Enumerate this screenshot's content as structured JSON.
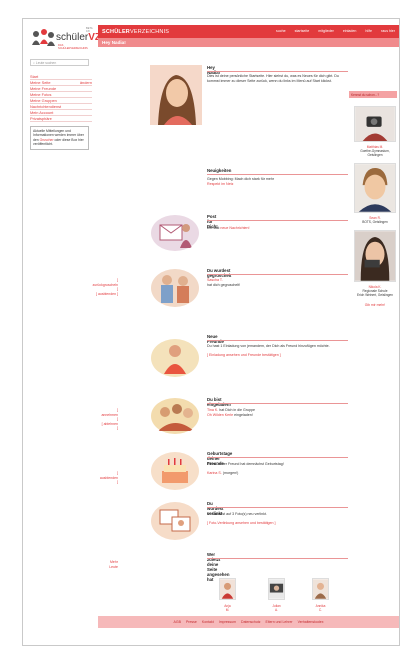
{
  "brand": {
    "name_bold": "SCHÜLER",
    "name_light": "VERZEICHNIS",
    "logo_text_1": "schüler",
    "logo_text_2": "VZ",
    "logo_tag": "DAS SCHÜLERVERZEICHNIS",
    "beta": "BETA 0.8"
  },
  "topnav": [
    "suche",
    "startseite",
    "mitglieder",
    "einladen",
    "hilfe",
    "raus hier"
  ],
  "subbar": {
    "greeting": "Hey Nadia!"
  },
  "sidebar": {
    "search_placeholder": "Leute suchen",
    "items": [
      "Start",
      "Meine Seite",
      "Meine Freunde",
      "Meine Fotos",
      "Meine Gruppen",
      "Nachrichtendienst",
      "Mein Account",
      "Privatsphäre"
    ],
    "edit_label": "ändern",
    "info_text_1": "Aktuelle Mitteilungen und Informationen werden immer über den",
    "info_link": "Gruscher",
    "info_text_2": "oder diese Box hier veröffentlicht."
  },
  "sections": {
    "welcome": {
      "title": "Hey Nadia!",
      "text": "Dies ist deine persönliche Startseite. Hier siehst du, was es Neues für dich gibt. Du kommst immer zu dieser Seite zurück, wenn du links im Menü auf Start klickst."
    },
    "news": {
      "title": "Neuigkeiten",
      "text": "Gegen Mobbing: Mach dich stark für mehr",
      "link": "Respekt im Netz"
    },
    "mail": {
      "title": "Post für Dich!",
      "text": "Du hast",
      "link": "neue Nachrichten!"
    },
    "poke": {
      "title": "Du wurdest gegruschelt",
      "name": "Sascha T.",
      "text": "hat dich gegruschelt!",
      "action1": "[ zurückgruscheln ]",
      "action2": "[ ausblenden ]"
    },
    "friends": {
      "title": "Neue Freunde",
      "text": "Du hast 1 Einladung von jemandem, der Dich als Freund hinzufügen möchte.",
      "link": "[ Einladung ansehen und Freunde bestätigen ]"
    },
    "invite": {
      "title": "Du bist eingeladen!",
      "line1_name": "Tina K.",
      "line1_text": "hat Dich in die Gruppe",
      "line2_link": "Oh Wilden Kerle",
      "line2_text": "eingeladen!",
      "action1": "[ annehmen ]",
      "action2": "[ ablehnen ]"
    },
    "birthday": {
      "title": "Geburtstage deiner Freunde",
      "text": "Einer Deiner Freund hat demnächst Geburtstag!",
      "name": "Karina S.",
      "when": "(morgen!)",
      "action": "[ ausblenden ]"
    },
    "tagged": {
      "title": "Du wurdest verlinkt",
      "text": "Du wurdest auf 3 Foto(s) neu verlinkt.",
      "link": "[ Foto-Verlinkung ansehen und bestätigen ]"
    },
    "visitors": {
      "title": "Wer zuletzt deine Seite angesehen hat",
      "more": "Mehr Leute",
      "people": [
        {
          "first": "Anja",
          "last": "M."
        },
        {
          "first": "Julian",
          "last": "A."
        },
        {
          "first": "Annika",
          "last": "C."
        }
      ]
    }
  },
  "rightcol": {
    "header": "Kennst du schon...?",
    "people": [
      {
        "name": "Matthias M.",
        "school": "Goethe-Gymnasium,",
        "city": "Geislingen"
      },
      {
        "name": "Sean R.",
        "school": "BOTS, Geislingen",
        "city": ""
      },
      {
        "name": "Nikola K.",
        "school": "Regionale Schule",
        "city": "Erich Weinert, Geislingen"
      }
    ],
    "more": "Gib mir mehr!"
  },
  "footer": [
    "AGB",
    "Presse",
    "Kontakt",
    "Impressum",
    "Datenschutz",
    "Eltern und Lehrer",
    "Verhaltenskodex"
  ]
}
